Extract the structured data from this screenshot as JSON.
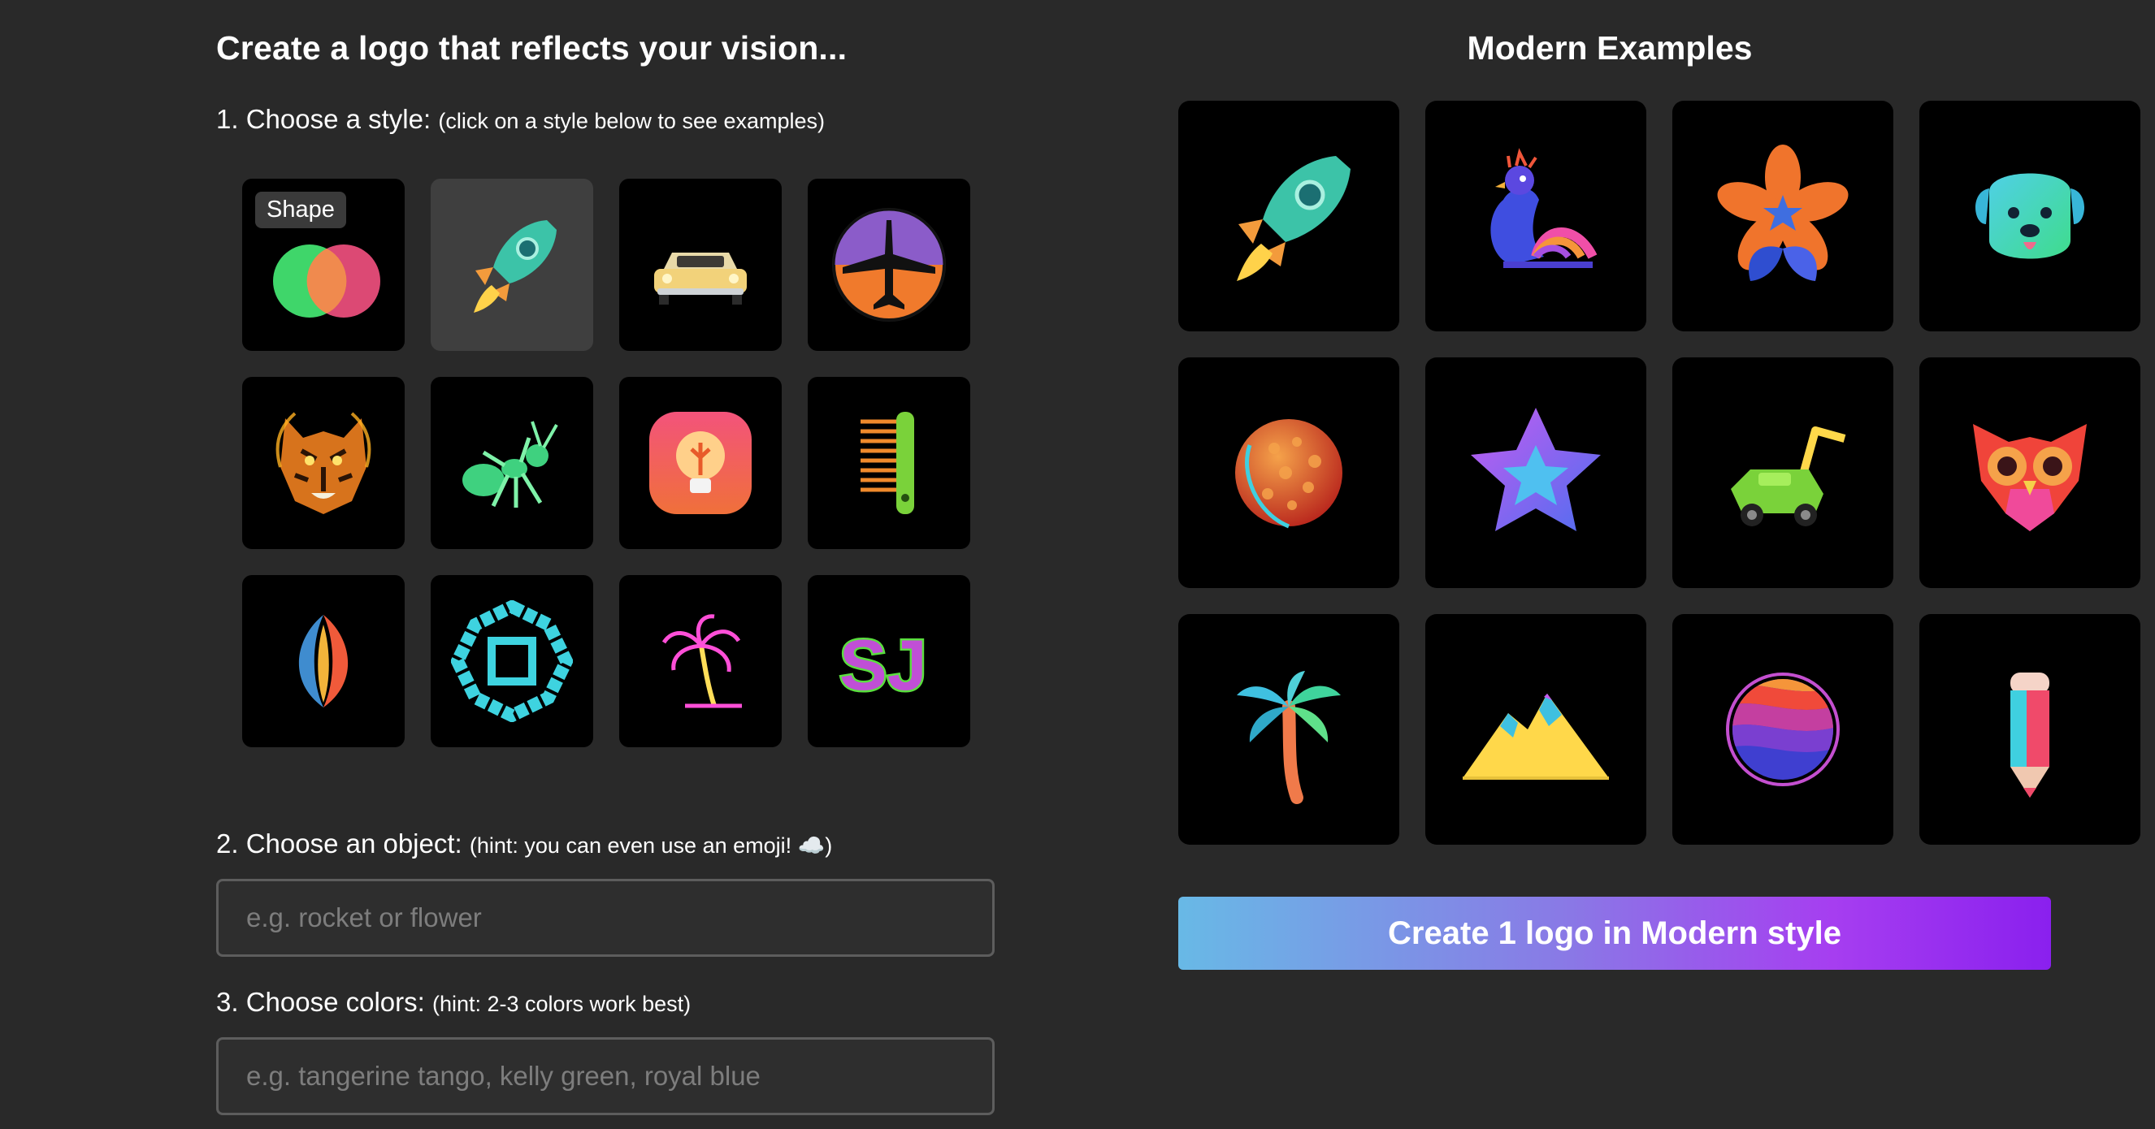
{
  "left": {
    "headline": "Create a logo that reflects your vision...",
    "step1": {
      "label": "1. Choose a style:",
      "hint": "(click on a style below to see examples)"
    },
    "tooltip": "Shape",
    "styles": [
      "Shape",
      "Modern",
      "Car",
      "Plane",
      "Tiger",
      "Ant",
      "Lightbulb",
      "Comb",
      "Leaf",
      "Geometric",
      "Palm",
      "Monogram"
    ],
    "selected_style": "Modern",
    "step2": {
      "label": "2. Choose an object:",
      "hint": "(hint: you can even use an emoji! ☁️)"
    },
    "object_input": {
      "placeholder": "e.g. rocket or flower",
      "value": ""
    },
    "step3": {
      "label": "3. Choose colors:",
      "hint": "(hint: 2-3 colors work best)"
    },
    "colors_input": {
      "placeholder": "e.g. tangerine tango, kelly green, royal blue",
      "value": ""
    }
  },
  "right": {
    "title": "Modern Examples",
    "examples": [
      "rocket-icon",
      "peacock-icon",
      "flower-icon",
      "dog-icon",
      "planet-icon",
      "star-icon",
      "lawnmower-icon",
      "owl-icon",
      "palm-tree-icon",
      "mountain-icon",
      "sunset-circle-icon",
      "pencil-icon"
    ],
    "create_button": "Create 1 logo in Modern style"
  },
  "colors": {
    "background": "#292929",
    "tile": "#000000",
    "selected_tile": "#3f3f3f",
    "button_gradient_start": "#68b9e6",
    "button_gradient_end": "#8a20ee"
  }
}
